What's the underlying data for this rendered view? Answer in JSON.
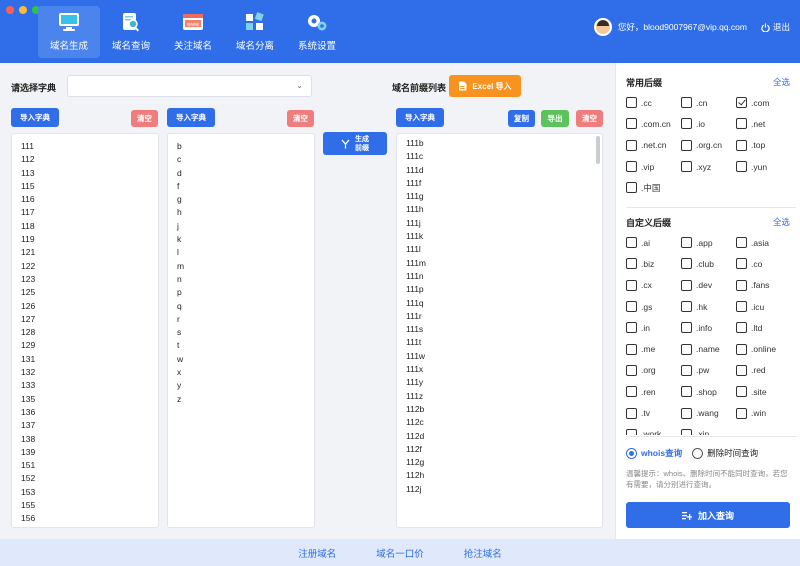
{
  "window": {
    "controls": [
      "close",
      "minimize",
      "maximize"
    ]
  },
  "nav": [
    {
      "label": "域名生成",
      "icon": "monitor-icon",
      "active": true
    },
    {
      "label": "域名查询",
      "icon": "search-doc-icon"
    },
    {
      "label": "关注域名",
      "icon": "www-icon"
    },
    {
      "label": "域名分离",
      "icon": "split-cube-icon"
    },
    {
      "label": "系统设置",
      "icon": "gears-icon"
    }
  ],
  "user": {
    "greeting": "您好，blood9007967@vip.qq.com",
    "logout": "退出"
  },
  "toolbar": {
    "dict_label": "请选择字典",
    "dict_value": "",
    "prefix_label": "域名前缀列表",
    "excel_label": "Excel 导入"
  },
  "col1": {
    "import_label": "导入字典",
    "clear_label": "清空",
    "items": [
      "111",
      "112",
      "113",
      "115",
      "116",
      "117",
      "118",
      "119",
      "121",
      "122",
      "123",
      "125",
      "126",
      "127",
      "128",
      "129",
      "131",
      "132",
      "133",
      "135",
      "136",
      "137",
      "138",
      "139",
      "151",
      "152",
      "153",
      "155",
      "156"
    ]
  },
  "col2": {
    "import_label": "导入字典",
    "clear_label": "清空",
    "items": [
      "b",
      "c",
      "d",
      "f",
      "g",
      "h",
      "j",
      "k",
      "l",
      "m",
      "n",
      "p",
      "q",
      "r",
      "s",
      "t",
      "w",
      "x",
      "y",
      "z"
    ]
  },
  "generate": {
    "label_line1": "生成",
    "label_line2": "前缀"
  },
  "col3": {
    "import_label": "导入字典",
    "copy_label": "复制",
    "export_label": "导出",
    "clear_label": "清空",
    "items": [
      "111b",
      "111c",
      "111d",
      "111f",
      "111g",
      "111h",
      "111j",
      "111k",
      "111l",
      "111m",
      "111n",
      "111p",
      "111q",
      "111r",
      "111s",
      "111t",
      "111w",
      "111x",
      "111y",
      "111z",
      "112b",
      "112c",
      "112d",
      "112f",
      "112g",
      "112h",
      "112j"
    ]
  },
  "common_suffix": {
    "title": "常用后缀",
    "select_all": "全选",
    "items": [
      {
        "label": ".cc",
        "checked": false
      },
      {
        "label": ".cn",
        "checked": false
      },
      {
        "label": ".com",
        "checked": true
      },
      {
        "label": ".com.cn",
        "checked": false
      },
      {
        "label": ".io",
        "checked": false
      },
      {
        "label": ".net",
        "checked": false
      },
      {
        "label": ".net.cn",
        "checked": false
      },
      {
        "label": ".org.cn",
        "checked": false
      },
      {
        "label": ".top",
        "checked": false
      },
      {
        "label": ".vip",
        "checked": false
      },
      {
        "label": ".xyz",
        "checked": false
      },
      {
        "label": ".yun",
        "checked": false
      },
      {
        "label": ".中国",
        "checked": false
      }
    ]
  },
  "custom_suffix": {
    "title": "自定义后缀",
    "select_all": "全选",
    "items": [
      {
        "label": ".ai"
      },
      {
        "label": ".app"
      },
      {
        "label": ".asia"
      },
      {
        "label": ".biz"
      },
      {
        "label": ".club"
      },
      {
        "label": ".co"
      },
      {
        "label": ".cx"
      },
      {
        "label": ".dev"
      },
      {
        "label": ".fans"
      },
      {
        "label": ".gs"
      },
      {
        "label": ".hk"
      },
      {
        "label": ".icu"
      },
      {
        "label": ".in"
      },
      {
        "label": ".info"
      },
      {
        "label": ".ltd"
      },
      {
        "label": ".me"
      },
      {
        "label": ".name"
      },
      {
        "label": ".online"
      },
      {
        "label": ".org"
      },
      {
        "label": ".pw"
      },
      {
        "label": ".red"
      },
      {
        "label": ".ren"
      },
      {
        "label": ".shop"
      },
      {
        "label": ".site"
      },
      {
        "label": ".tv"
      },
      {
        "label": ".wang"
      },
      {
        "label": ".win"
      },
      {
        "label": ".work"
      },
      {
        "label": ".xin"
      }
    ]
  },
  "query_mode": {
    "whois": "whois查询",
    "delete_time": "删除时间查询",
    "selected": "whois"
  },
  "tip": "温馨提示：whois、删除时间不能同时查询，若您有需要，请分别进行查询。",
  "query_button": "加入查询",
  "footer": [
    "注册域名",
    "域名一口价",
    "抢注域名"
  ],
  "colors": {
    "primary": "#2f6ee8",
    "orange": "#f7931e",
    "red": "#f07d7d",
    "green": "#5cc35c"
  }
}
